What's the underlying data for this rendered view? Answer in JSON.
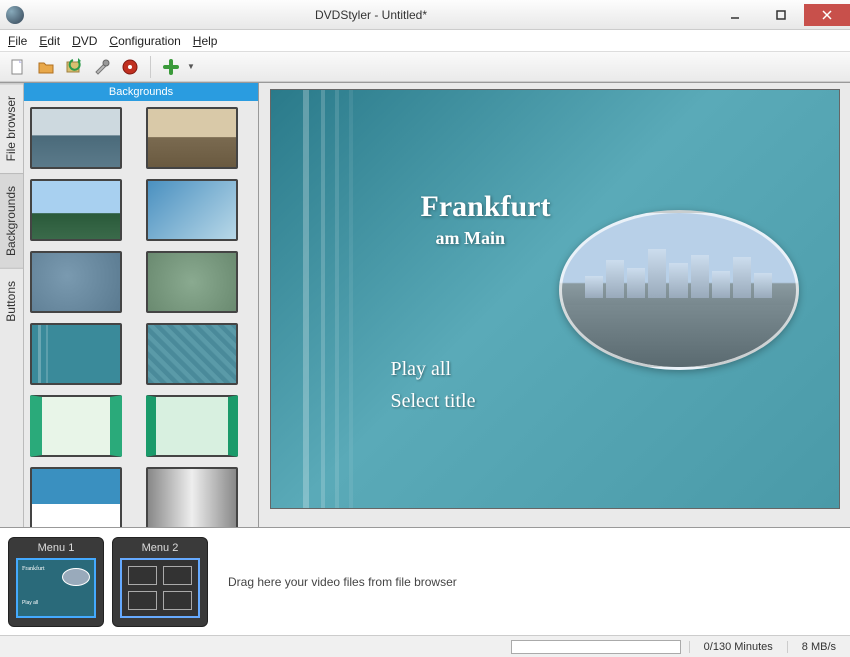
{
  "window": {
    "title": "DVDStyler - Untitled*"
  },
  "menu": {
    "file": "File",
    "edit": "Edit",
    "dvd": "DVD",
    "configuration": "Configuration",
    "help": "Help"
  },
  "toolbar_icons": {
    "new": "new-file-icon",
    "open": "open-folder-icon",
    "save": "save-refresh-icon",
    "settings": "wrench-icon",
    "burn": "burn-disc-icon",
    "add": "add-plus-icon"
  },
  "sidebar_tabs": {
    "file_browser": "File browser",
    "backgrounds": "Backgrounds",
    "buttons": "Buttons"
  },
  "panel": {
    "header": "Backgrounds",
    "thumbs": [
      "ocean",
      "ship",
      "island",
      "skygrad",
      "blueblur",
      "greenblur",
      "tealstripe",
      "tealtex",
      "greenframe",
      "greenframe2",
      "bluecut",
      "grayshine"
    ]
  },
  "preview": {
    "title_main": "Frankfurt",
    "title_sub": "am Main",
    "option1": "Play all",
    "option2": "Select title"
  },
  "timeline": {
    "menu1": "Menu 1",
    "menu2": "Menu 2",
    "hint": "Drag here your video files from file browser"
  },
  "status": {
    "minutes": "0/130 Minutes",
    "bitrate": "8 MB/s"
  }
}
